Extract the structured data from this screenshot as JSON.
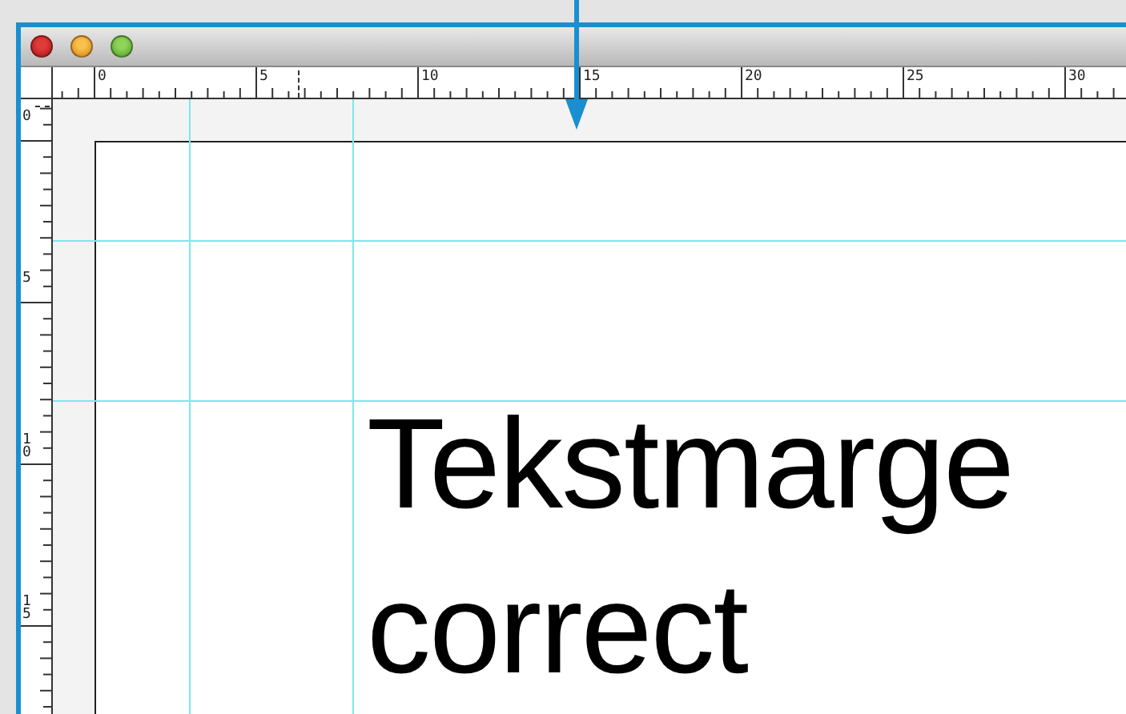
{
  "horizontal_ruler": {
    "labels": [
      "0",
      "5",
      "10",
      "15",
      "20",
      "25",
      "30"
    ]
  },
  "vertical_ruler": {
    "labels": [
      "0",
      "5",
      "10",
      "15"
    ]
  },
  "document": {
    "lines": [
      "Tekstmarge",
      "correct"
    ]
  }
}
